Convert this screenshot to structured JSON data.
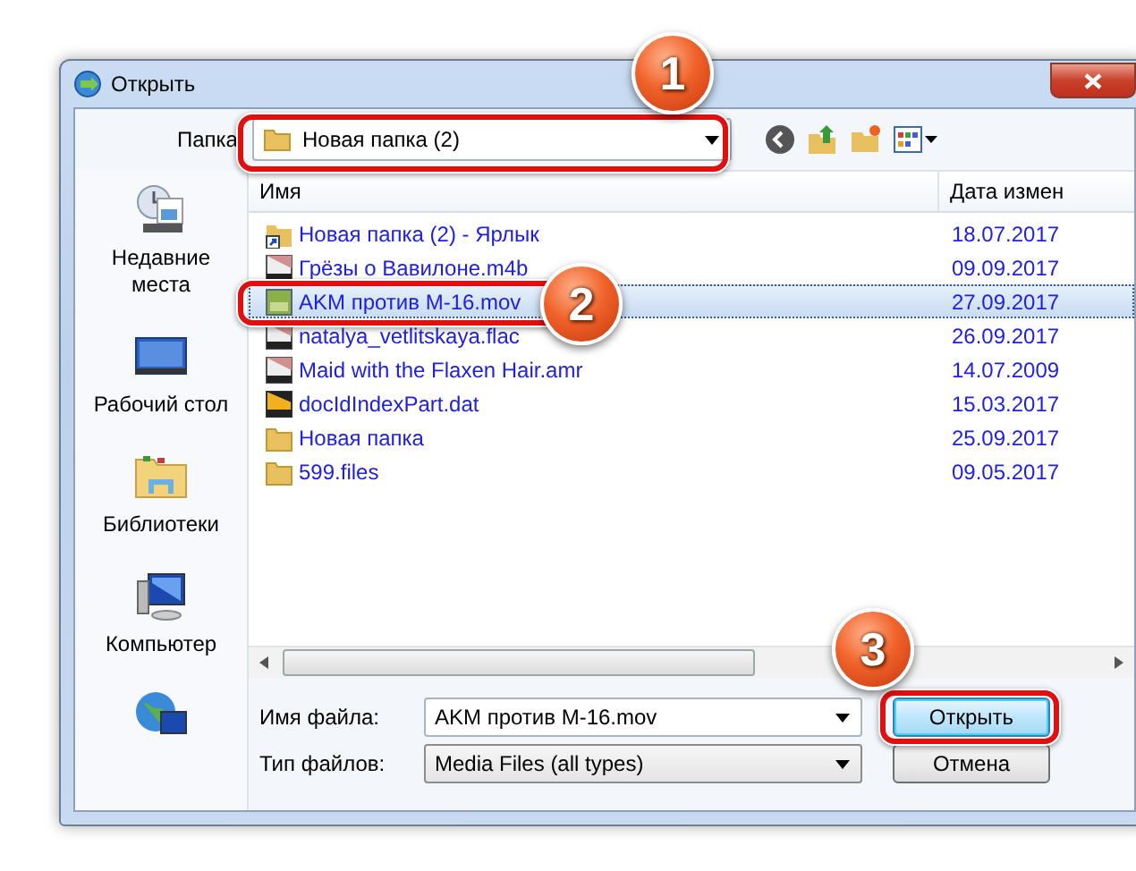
{
  "window": {
    "title": "Открыть"
  },
  "toolbar": {
    "label": "Папка",
    "folder": "Новая папка (2)"
  },
  "sidebar": {
    "items": [
      {
        "kind": "recent",
        "label": "Недавние места"
      },
      {
        "kind": "desktop",
        "label": "Рабочий стол"
      },
      {
        "kind": "libraries",
        "label": "Библиотеки"
      },
      {
        "kind": "computer",
        "label": "Компьютер"
      },
      {
        "kind": "network"
      }
    ]
  },
  "table": {
    "columns": [
      "Имя",
      "Дата измен"
    ],
    "rows": [
      {
        "kind": "shortcut",
        "name": "Новая папка (2) - Ярлык",
        "date": "18.07.2017",
        "selected": false
      },
      {
        "kind": "media",
        "name": "Грёзы о Вавилоне.m4b",
        "date": "09.09.2017",
        "selected": false
      },
      {
        "kind": "video",
        "name": "AKM против M-16.mov",
        "date": "27.09.2017",
        "selected": true
      },
      {
        "kind": "media",
        "name": "natalya_vetlitskaya.flac",
        "date": "26.09.2017",
        "selected": false
      },
      {
        "kind": "media",
        "name": "Maid with the Flaxen Hair.amr",
        "date": "14.07.2009",
        "selected": false
      },
      {
        "kind": "data",
        "name": "docIdIndexPart.dat",
        "date": "15.03.2017",
        "selected": false
      },
      {
        "kind": "folder",
        "name": "Новая папка",
        "date": "25.09.2017",
        "selected": false
      },
      {
        "kind": "folder",
        "name": "599.files",
        "date": "09.05.2017",
        "selected": false
      }
    ]
  },
  "fields": {
    "filename_label": "Имя файла:",
    "filename": "AKM против M-16.mov",
    "type_label": "Тип файлов:",
    "type": "Media Files (all types)"
  },
  "buttons": [
    "Открыть",
    "Отмена"
  ],
  "annotations": [
    {
      "number": "1"
    },
    {
      "number": "2"
    },
    {
      "number": "3"
    }
  ]
}
